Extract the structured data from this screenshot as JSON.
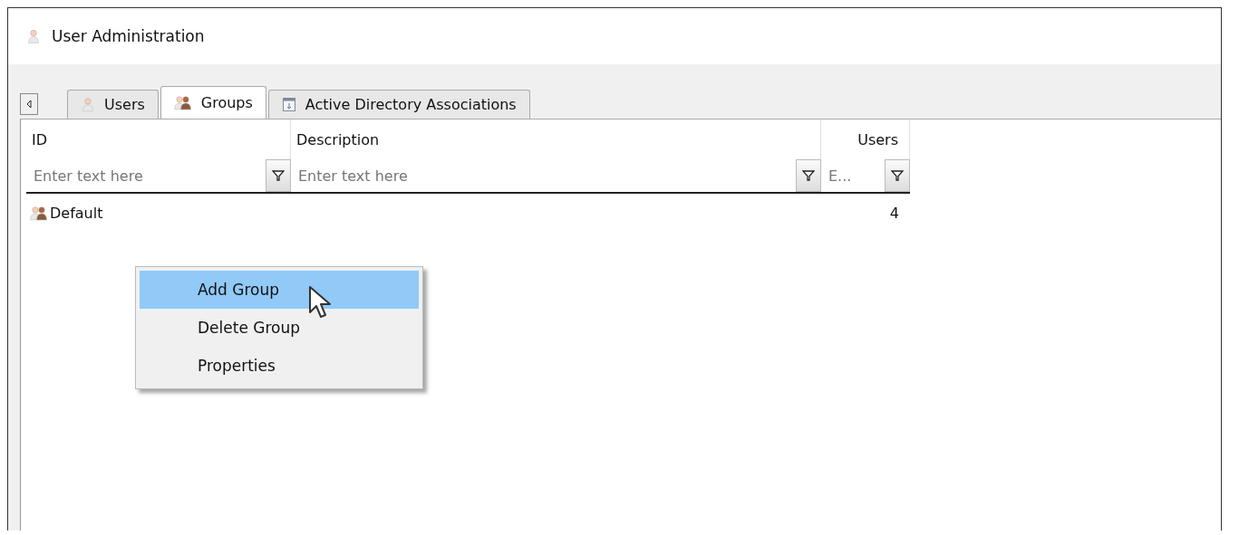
{
  "window": {
    "title": "User Administration"
  },
  "tabs": [
    {
      "label": "Users",
      "kind": "user",
      "selected": false
    },
    {
      "label": "Groups",
      "kind": "group",
      "selected": true
    },
    {
      "label": "Active Directory Associations",
      "kind": "directory",
      "selected": false
    }
  ],
  "table": {
    "columns": [
      {
        "label": "ID",
        "placeholder": "Enter text here"
      },
      {
        "label": "Description",
        "placeholder": "Enter text here"
      },
      {
        "label": "Users",
        "placeholder": "E..."
      }
    ],
    "rows": [
      {
        "id": "Default",
        "users": "4"
      }
    ]
  },
  "context_menu": [
    {
      "label": "Add Group",
      "selected": true
    },
    {
      "label": "Delete Group",
      "selected": false
    },
    {
      "label": "Properties",
      "selected": false
    }
  ]
}
